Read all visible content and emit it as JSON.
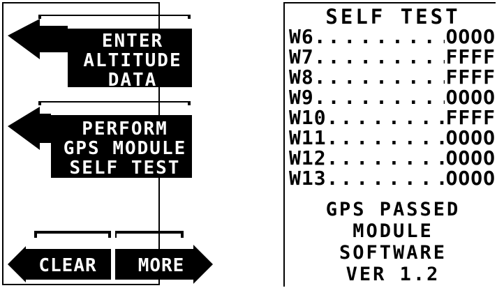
{
  "softkeys": {
    "altitude": "ENTER\nALTITUDE\nDATA",
    "selftest": "PERFORM\nGPS MODULE\nSELF TEST",
    "clear": "CLEAR",
    "more": "MORE"
  },
  "self_test": {
    "title": "SELF TEST",
    "rows": [
      {
        "label": "W6.",
        "value": "OOOO"
      },
      {
        "label": "W7.",
        "value": "FFFF"
      },
      {
        "label": "W8.",
        "value": "FFFF"
      },
      {
        "label": "W9.",
        "value": "OOOO"
      },
      {
        "label": "W10.",
        "value": "FFFF"
      },
      {
        "label": "W11.",
        "value": "OOOO"
      },
      {
        "label": "W12.",
        "value": "OOOO"
      },
      {
        "label": "W13.",
        "value": "OOOO"
      }
    ],
    "status_line1": "GPS PASSED",
    "status_line2": "MODULE",
    "status_line3": "SOFTWARE",
    "status_line4": "VER 1.2"
  },
  "colors": {
    "ink": "#000000",
    "paper": "#ffffff"
  }
}
